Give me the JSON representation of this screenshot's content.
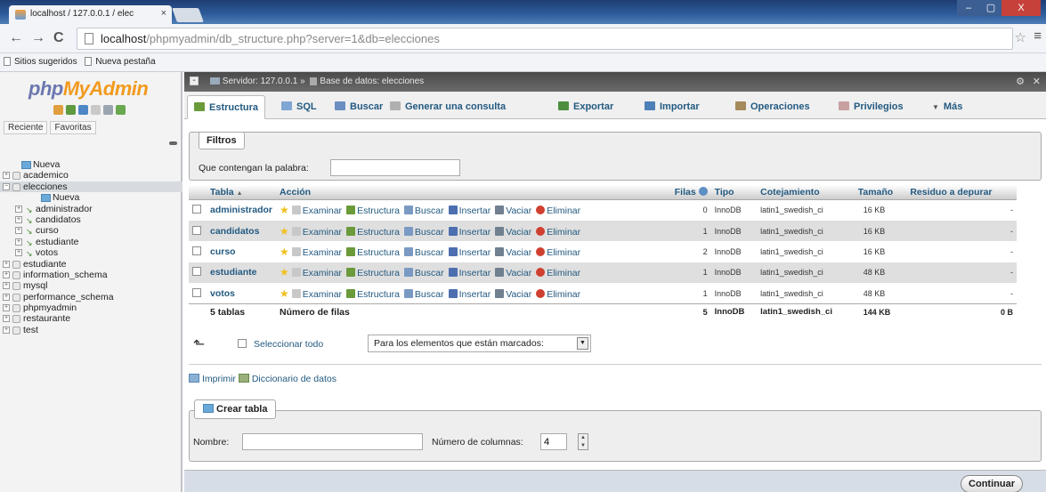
{
  "browser": {
    "tab_title": "localhost / 127.0.0.1 / elec",
    "tab_close": "×",
    "address_host": "localhost",
    "address_path": "/phpmyadmin/db_structure.php?server=1&db=elecciones",
    "bookmarks": [
      "Sitios sugeridos",
      "Nueva pestaña"
    ],
    "win_min": "–",
    "win_max": "▢",
    "win_close": "X"
  },
  "sidebar": {
    "logo_php": "php",
    "logo_myadmin": "MyAdmin",
    "tabs": [
      "Reciente",
      "Favoritas"
    ],
    "tree": [
      {
        "label": "Nueva",
        "kind": "new",
        "level": 0
      },
      {
        "label": "academico",
        "kind": "db",
        "level": 0
      },
      {
        "label": "elecciones",
        "kind": "db",
        "level": 0,
        "selected": true
      },
      {
        "label": "Nueva",
        "kind": "new",
        "level": 1
      },
      {
        "label": "administrador",
        "kind": "table",
        "level": 1
      },
      {
        "label": "candidatos",
        "kind": "table",
        "level": 1
      },
      {
        "label": "curso",
        "kind": "table",
        "level": 1
      },
      {
        "label": "estudiante",
        "kind": "table",
        "level": 1
      },
      {
        "label": "votos",
        "kind": "table",
        "level": 1
      },
      {
        "label": "estudiante",
        "kind": "db",
        "level": 0
      },
      {
        "label": "information_schema",
        "kind": "db",
        "level": 0
      },
      {
        "label": "mysql",
        "kind": "db",
        "level": 0
      },
      {
        "label": "performance_schema",
        "kind": "db",
        "level": 0
      },
      {
        "label": "phpmyadmin",
        "kind": "db",
        "level": 0
      },
      {
        "label": "restaurante",
        "kind": "db",
        "level": 0
      },
      {
        "label": "test",
        "kind": "db",
        "level": 0
      }
    ]
  },
  "breadcrumb": {
    "server": "Servidor: 127.0.0.1",
    "sep": "»",
    "database": "Base de datos: elecciones"
  },
  "tabs": [
    {
      "label": "Estructura",
      "icon": "structure-icon",
      "color": "#6a9a3a"
    },
    {
      "label": "SQL",
      "icon": "sql-icon",
      "color": "#7fa6d4"
    },
    {
      "label": "Buscar",
      "icon": "search-icon",
      "color": "#6a8fc0"
    },
    {
      "label": "Generar una consulta",
      "icon": "query-icon",
      "color": "#b0b0b0"
    },
    {
      "label": "Exportar",
      "icon": "export-icon",
      "color": "#4d8f3f"
    },
    {
      "label": "Importar",
      "icon": "import-icon",
      "color": "#4d7fb8"
    },
    {
      "label": "Operaciones",
      "icon": "operations-icon",
      "color": "#a58a5c"
    },
    {
      "label": "Privilegios",
      "icon": "privileges-icon",
      "color": "#c9a0a0"
    },
    {
      "label": "Más",
      "icon": "chevron-down-icon",
      "color": "#555555"
    }
  ],
  "filters": {
    "legend": "Filtros",
    "label": "Que contengan la palabra:",
    "value": ""
  },
  "table": {
    "headers": {
      "table": "Tabla",
      "sort_arrow": "▲",
      "action": "Acción",
      "rows": "Filas",
      "type": "Tipo",
      "collation": "Cotejamiento",
      "size": "Tamaño",
      "overhead": "Residuo a depurar"
    },
    "action_labels": [
      "Examinar",
      "Estructura",
      "Buscar",
      "Insertar",
      "Vaciar",
      "Eliminar"
    ],
    "action_icon_colors": [
      "#c8c8c8",
      "#6a9a3a",
      "#7a9ac4",
      "#4d6fb0",
      "#708090",
      "#d04030"
    ],
    "rows": [
      {
        "name": "administrador",
        "rows": "0",
        "type": "InnoDB",
        "collation": "latin1_swedish_ci",
        "size": "16 KB",
        "overhead": "-"
      },
      {
        "name": "candidatos",
        "rows": "1",
        "type": "InnoDB",
        "collation": "latin1_swedish_ci",
        "size": "16 KB",
        "overhead": "-"
      },
      {
        "name": "curso",
        "rows": "2",
        "type": "InnoDB",
        "collation": "latin1_swedish_ci",
        "size": "16 KB",
        "overhead": "-"
      },
      {
        "name": "estudiante",
        "rows": "1",
        "type": "InnoDB",
        "collation": "latin1_swedish_ci",
        "size": "48 KB",
        "overhead": "-"
      },
      {
        "name": "votos",
        "rows": "1",
        "type": "InnoDB",
        "collation": "latin1_swedish_ci",
        "size": "48 KB",
        "overhead": "-"
      }
    ],
    "totals": {
      "tables": "5 tablas",
      "label": "Número de filas",
      "rows": "5",
      "type": "InnoDB",
      "collation": "latin1_swedish_ci",
      "size": "144 KB",
      "overhead": "0 B"
    }
  },
  "selection": {
    "select_all": "Seleccionar todo",
    "bulk_placeholder": "Para los elementos que están marcados:"
  },
  "links": {
    "print": "Imprimir",
    "dictionary": "Diccionario de datos"
  },
  "create": {
    "legend": "Crear tabla",
    "name_label": "Nombre:",
    "name_value": "",
    "cols_label": "Número de columnas:",
    "cols_value": "4",
    "submit": "Continuar"
  }
}
